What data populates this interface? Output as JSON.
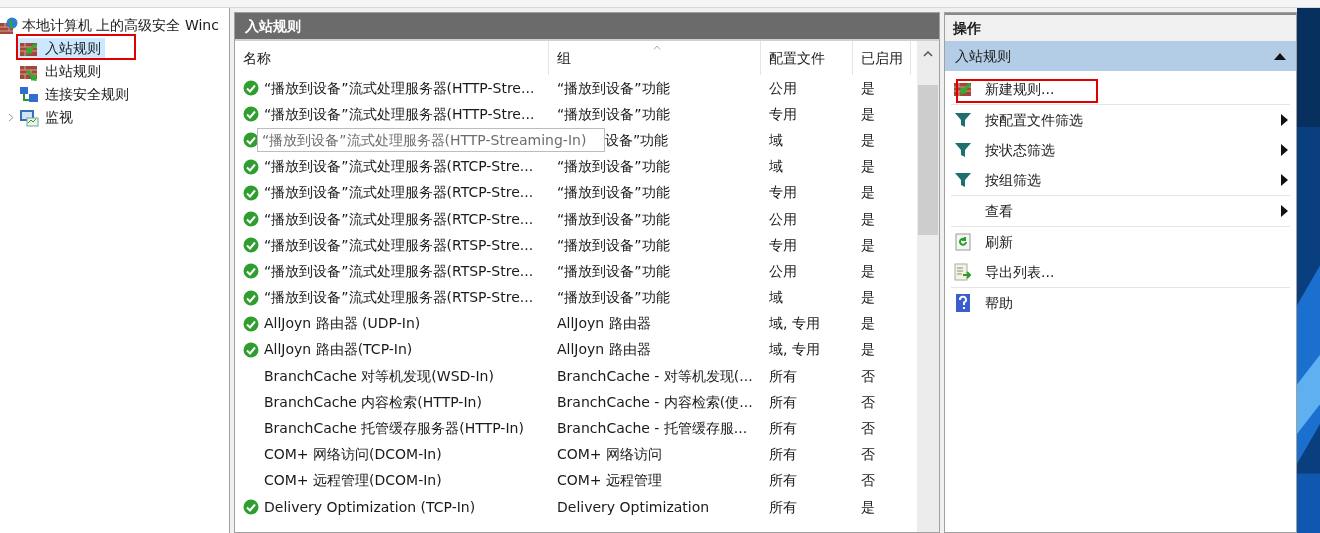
{
  "tree": {
    "root": {
      "label": "本地计算机 上的高级安全 Winc"
    },
    "items": [
      {
        "label": "入站规则",
        "kind": "inbound",
        "selected": true,
        "expandable": false,
        "annotated": true
      },
      {
        "label": "出站规则",
        "kind": "outbound",
        "selected": false,
        "expandable": false,
        "annotated": false
      },
      {
        "label": "连接安全规则",
        "kind": "connection",
        "selected": false,
        "expandable": false,
        "annotated": false
      },
      {
        "label": "监视",
        "kind": "monitor",
        "selected": false,
        "expandable": true,
        "annotated": false
      }
    ]
  },
  "center": {
    "title": "入站规则",
    "columns": [
      "名称",
      "组",
      "配置文件",
      "已启用"
    ],
    "rows": [
      {
        "name": "“播放到设备”流式处理服务器(HTTP-Stre...",
        "group": "“播放到设备”功能",
        "profile": "公用",
        "enabled": "是",
        "active": true
      },
      {
        "name": "“播放到设备”流式处理服务器(HTTP-Stre...",
        "group": "“播放到设备”功能",
        "profile": "专用",
        "enabled": "是",
        "active": true
      },
      {
        "tooltip": "“播放到设备”流式处理服务器(HTTP-Streaming-In)",
        "group": "设备”功能",
        "profile": "域",
        "enabled": "是",
        "active": true
      },
      {
        "name": "“播放到设备”流式处理服务器(RTCP-Stre...",
        "group": "“播放到设备”功能",
        "profile": "域",
        "enabled": "是",
        "active": true
      },
      {
        "name": "“播放到设备”流式处理服务器(RTCP-Stre...",
        "group": "“播放到设备”功能",
        "profile": "专用",
        "enabled": "是",
        "active": true
      },
      {
        "name": "“播放到设备”流式处理服务器(RTCP-Stre...",
        "group": "“播放到设备”功能",
        "profile": "公用",
        "enabled": "是",
        "active": true
      },
      {
        "name": "“播放到设备”流式处理服务器(RTSP-Stre...",
        "group": "“播放到设备”功能",
        "profile": "专用",
        "enabled": "是",
        "active": true
      },
      {
        "name": "“播放到设备”流式处理服务器(RTSP-Stre...",
        "group": "“播放到设备”功能",
        "profile": "公用",
        "enabled": "是",
        "active": true
      },
      {
        "name": "“播放到设备”流式处理服务器(RTSP-Stre...",
        "group": "“播放到设备”功能",
        "profile": "域",
        "enabled": "是",
        "active": true
      },
      {
        "name": "AllJoyn 路由器 (UDP-In)",
        "group": "AllJoyn 路由器",
        "profile": "域, 专用",
        "enabled": "是",
        "active": true
      },
      {
        "name": "AllJoyn 路由器(TCP-In)",
        "group": "AllJoyn 路由器",
        "profile": "域, 专用",
        "enabled": "是",
        "active": true
      },
      {
        "name": "BranchCache 对等机发现(WSD-In)",
        "group": "BranchCache - 对等机发现(...",
        "profile": "所有",
        "enabled": "否",
        "active": false
      },
      {
        "name": "BranchCache 内容检索(HTTP-In)",
        "group": "BranchCache - 内容检索(使...",
        "profile": "所有",
        "enabled": "否",
        "active": false
      },
      {
        "name": "BranchCache 托管缓存服务器(HTTP-In)",
        "group": "BranchCache - 托管缓存服...",
        "profile": "所有",
        "enabled": "否",
        "active": false
      },
      {
        "name": "COM+ 网络访问(DCOM-In)",
        "group": "COM+ 网络访问",
        "profile": "所有",
        "enabled": "否",
        "active": false
      },
      {
        "name": "COM+ 远程管理(DCOM-In)",
        "group": "COM+ 远程管理",
        "profile": "所有",
        "enabled": "否",
        "active": false
      },
      {
        "name": "Delivery Optimization (TCP-In)",
        "group": "Delivery Optimization",
        "profile": "所有",
        "enabled": "是",
        "active": true
      }
    ]
  },
  "actions": {
    "title": "操作",
    "section": {
      "title": "入站规则",
      "expanded": true
    },
    "groups": [
      [
        {
          "label": "新建规则...",
          "kind": "new_rule",
          "submenu": false,
          "annotated": true
        }
      ],
      [
        {
          "label": "按配置文件筛选",
          "kind": "filter",
          "submenu": true,
          "annotated": false
        },
        {
          "label": "按状态筛选",
          "kind": "filter",
          "submenu": true,
          "annotated": false
        },
        {
          "label": "按组筛选",
          "kind": "filter",
          "submenu": true,
          "annotated": false
        }
      ],
      [
        {
          "label": "查看",
          "kind": "none",
          "submenu": true,
          "annotated": false
        }
      ],
      [
        {
          "label": "刷新",
          "kind": "refresh",
          "submenu": false,
          "annotated": false
        },
        {
          "label": "导出列表...",
          "kind": "export",
          "submenu": false,
          "annotated": false
        }
      ],
      [
        {
          "label": "帮助",
          "kind": "help",
          "submenu": false,
          "annotated": false
        }
      ]
    ]
  }
}
